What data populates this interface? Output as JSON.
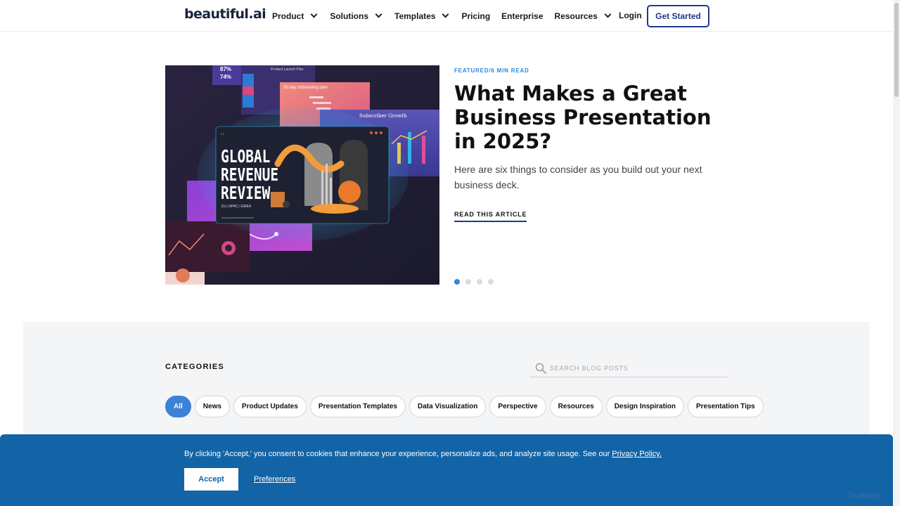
{
  "nav": {
    "logo": "beautiful.ai",
    "items": [
      {
        "label": "Product",
        "dropdown": true
      },
      {
        "label": "Solutions",
        "dropdown": true
      },
      {
        "label": "Templates",
        "dropdown": true
      },
      {
        "label": "Pricing",
        "dropdown": false
      },
      {
        "label": "Enterprise",
        "dropdown": false
      },
      {
        "label": "Resources",
        "dropdown": true
      }
    ],
    "login": "Login",
    "cta": "Get Started"
  },
  "hero": {
    "tag": "FEATURED/6 MIN READ",
    "title": "What Makes a Great Business Presentation in 2025?",
    "description": "Here are six things to consider as you build out your next business deck.",
    "link": "READ THIS ARTICLE",
    "image_text": {
      "slide_main_line1": "GLOBAL",
      "slide_main_line2": "REVENUE",
      "slide_main_line3": "REVIEW",
      "slide_main_sub": "EU  |  APAC  |  EMEA",
      "onboarding": "30 day onboarding plan",
      "subscriber": "Subscriber Growth",
      "launch": "Product Launch Plan",
      "stat1": "87%",
      "stat2": "74%"
    },
    "carousel": {
      "count": 4,
      "active": 1
    }
  },
  "categories": {
    "title": "CATEGORIES",
    "search_placeholder": "SEARCH BLOG POSTS",
    "chips": [
      {
        "label": "All",
        "active": true
      },
      {
        "label": "News",
        "active": false
      },
      {
        "label": "Product Updates",
        "active": false
      },
      {
        "label": "Presentation Templates",
        "active": false
      },
      {
        "label": "Data Visualization",
        "active": false
      },
      {
        "label": "Perspective",
        "active": false
      },
      {
        "label": "Resources",
        "active": false
      },
      {
        "label": "Design Inspiration",
        "active": false
      },
      {
        "label": "Presentation Tips",
        "active": false
      }
    ]
  },
  "cookie": {
    "text": "By clicking 'Accept,' you consent to cookies that enhance your experience, personalize ads, and analyze site usage. See our",
    "policy_link": "Privacy Policy.",
    "accept": "Accept",
    "preferences": "Preferences"
  },
  "watermark": "ToolMage",
  "colors": {
    "accent": "#2e86d9",
    "brand_navy": "#1e3a8a",
    "cookie_bg": "#1264a6",
    "section_bg": "#f4f5f7"
  }
}
